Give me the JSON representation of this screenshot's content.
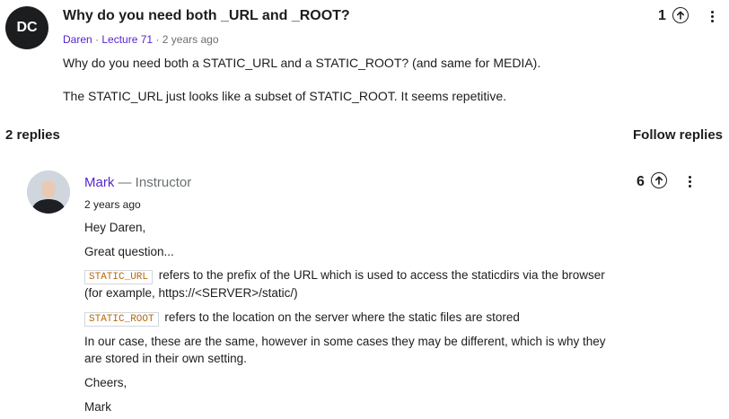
{
  "question": {
    "avatar_initials": "DC",
    "title": "Why do you need both _URL and _ROOT?",
    "author": "Daren",
    "lecture": "Lecture 71",
    "time": "2 years ago",
    "body": [
      "Why do you need both a STATIC_URL and a STATIC_ROOT? (and same for MEDIA).",
      "The STATIC_URL just looks like a subset of STATIC_ROOT. It seems repetitive."
    ],
    "upvotes": "1"
  },
  "replies_header": {
    "count_label": "2 replies",
    "follow_label": "Follow replies"
  },
  "reply": {
    "author": "Mark",
    "role": "— Instructor",
    "time": "2 years ago",
    "upvotes": "6",
    "greeting": "Hey Daren,",
    "line1": "Great question...",
    "code1": "STATIC_URL",
    "code1_text": "refers to the prefix of the URL which is used to access the staticdirs via the browser",
    "code1_text2": "(for example, https://<SERVER>/static/)",
    "code2": "STATIC_ROOT",
    "code2_text": "refers to the location on the server where the static files are stored",
    "para1": "In our case, these are the same, however in some cases they may be different, which is why they",
    "para2": "are stored in their own setting.",
    "signoff": "Cheers,",
    "signature": "Mark"
  },
  "icons": {
    "upvote": "arrow-up-circle-icon",
    "more": "more-vertical-icon"
  }
}
